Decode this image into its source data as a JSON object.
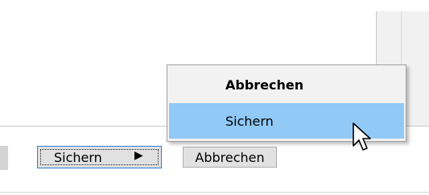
{
  "dialog": {
    "split_button": {
      "label": "Sichern",
      "arrow": "▶",
      "icon": "play-right-icon"
    },
    "cancel_button": {
      "label": "Abbrechen"
    }
  },
  "context_menu": {
    "items": [
      {
        "label": "Abbrechen",
        "default": true,
        "selected": false
      },
      {
        "label": "Sichern",
        "default": false,
        "selected": true
      }
    ]
  },
  "colors": {
    "menu_highlight": "#91c9f7",
    "button_face": "#e1e1e1",
    "focus_border": "#2b7fd6"
  }
}
